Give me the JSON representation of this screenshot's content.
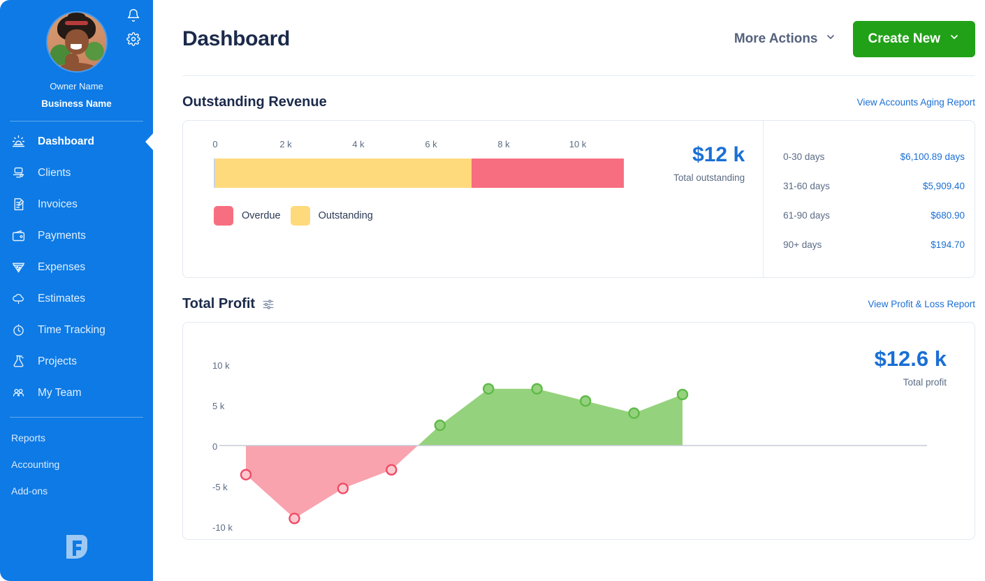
{
  "sidebar": {
    "profile": {
      "owner_name": "Owner Name",
      "business_name": "Business Name",
      "bell_icon": "bell-icon",
      "gear_icon": "gear-icon",
      "avatar_icon": "avatar"
    },
    "nav": [
      {
        "label": "Dashboard",
        "icon": "sun-icon",
        "active": true
      },
      {
        "label": "Clients",
        "icon": "client-icon",
        "active": false
      },
      {
        "label": "Invoices",
        "icon": "invoice-icon",
        "active": false
      },
      {
        "label": "Payments",
        "icon": "wallet-icon",
        "active": false
      },
      {
        "label": "Expenses",
        "icon": "pizza-icon",
        "active": false
      },
      {
        "label": "Estimates",
        "icon": "cloud-icon",
        "active": false
      },
      {
        "label": "Time Tracking",
        "icon": "stopwatch-icon",
        "active": false
      },
      {
        "label": "Projects",
        "icon": "flask-icon",
        "active": false
      },
      {
        "label": "My Team",
        "icon": "team-icon",
        "active": false
      }
    ],
    "sub_nav": [
      {
        "label": "Reports"
      },
      {
        "label": "Accounting"
      },
      {
        "label": "Add-ons"
      }
    ],
    "logo": "freshbooks-logo"
  },
  "header": {
    "title": "Dashboard",
    "more_actions_label": "More Actions",
    "create_new_label": "Create New",
    "chevron_icon": "chevron-down-icon"
  },
  "outstanding_revenue": {
    "title": "Outstanding Revenue",
    "link_label": "View Accounts Aging Report",
    "total_value": "$12 k",
    "total_label": "Total outstanding",
    "aging": [
      {
        "label": "0-30 days",
        "value": "$6,100.89 days"
      },
      {
        "label": "31-60 days",
        "value": "$5,909.40"
      },
      {
        "label": "61-90 days",
        "value": "$680.90"
      },
      {
        "label": "90+ days",
        "value": "$194.70"
      }
    ],
    "legend": [
      {
        "label": "Overdue",
        "color": "#F76E80"
      },
      {
        "label": "Outstanding",
        "color": "#FFDA7C"
      }
    ],
    "chart_data": {
      "type": "bar",
      "orientation": "horizontal",
      "title": "Outstanding Revenue",
      "xlabel": "",
      "ylabel": "",
      "xlim": [
        0,
        12500
      ],
      "tick_labels": [
        "0",
        "2 k",
        "4 k",
        "6 k",
        "8 k",
        "10 k"
      ],
      "tick_values": [
        0,
        2000,
        4000,
        6000,
        8000,
        10000
      ],
      "grid": false,
      "legend_position": "bottom-left",
      "categories": [
        "Outstanding Revenue"
      ],
      "series": [
        {
          "name": "Outstanding",
          "values": [
            7400
          ],
          "color": "#FFDA7C"
        },
        {
          "name": "Overdue",
          "values": [
            4400
          ],
          "color": "#F76E80"
        }
      ],
      "stacked": true,
      "total": 11800
    }
  },
  "total_profit": {
    "title": "Total Profit",
    "filter_icon": "sliders-icon",
    "link_label": "View Profit & Loss Report",
    "total_value": "$12.6 k",
    "total_label": "Total profit",
    "chart_data": {
      "type": "area",
      "title": "Total Profit",
      "xlabel": "",
      "ylabel": "",
      "ylim": [
        -10000,
        10000
      ],
      "ytick_labels": [
        "10 k",
        "5 k",
        "0",
        "-5 k",
        "-10 k"
      ],
      "ytick_values": [
        10000,
        5000,
        0,
        -5000,
        -10000
      ],
      "grid": false,
      "zero_line": true,
      "positive_color": "#95D27D",
      "negative_color": "#F9A3AE",
      "positive_marker_color": "#5FB94A",
      "negative_marker_color": "#F04A63",
      "x": [
        1,
        2,
        3,
        4,
        5,
        6,
        7,
        8,
        9,
        10
      ],
      "values": [
        -3600,
        -9000,
        -5300,
        -3000,
        2500,
        7000,
        7000,
        5500,
        4000,
        6300
      ]
    }
  }
}
